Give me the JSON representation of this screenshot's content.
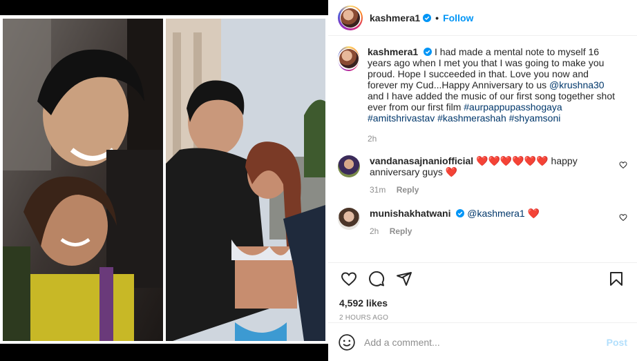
{
  "post": {
    "username": "kashmera1",
    "follow_label": "Follow",
    "dot": "•"
  },
  "caption": {
    "username": "kashmera1",
    "text_part1": "I had made a mental note to myself 16 years ago when I met you that I was going to make you proud. Hope I succeeded in that. Love you now and forever my Cud...Happy Anniversary to us",
    "mention": "@krushna30",
    "text_part2": "and I have added the music of our first song together shot ever from our first film",
    "hashtags": "#aurpappupasshogaya #amitshrivastav #kashmerashah #shyamsoni",
    "time": "2h"
  },
  "comments": [
    {
      "username": "vandanasajnaniofficial",
      "hearts": "❤️❤️❤️❤️❤️❤️",
      "text": "happy anniversary guys",
      "trailing": "❤️",
      "time": "31m",
      "reply": "Reply"
    },
    {
      "username": "munishakhatwani",
      "mention": "@kashmera1",
      "trailing": "❤️",
      "time": "2h",
      "reply": "Reply"
    }
  ],
  "stats": {
    "likes": "4,592 likes",
    "timestamp": "2 HOURS AGO"
  },
  "composer": {
    "placeholder": "Add a comment...",
    "post_label": "Post"
  },
  "colors": {
    "accent": "#0095f6",
    "heart": "#ed4956",
    "post_disabled": "#b2dffc"
  },
  "icons": {
    "like": "heart-outline-icon",
    "comment": "comment-bubble-icon",
    "share": "paper-plane-icon",
    "save": "bookmark-icon",
    "emoji": "smiley-icon",
    "verified": "verified-badge-icon"
  }
}
